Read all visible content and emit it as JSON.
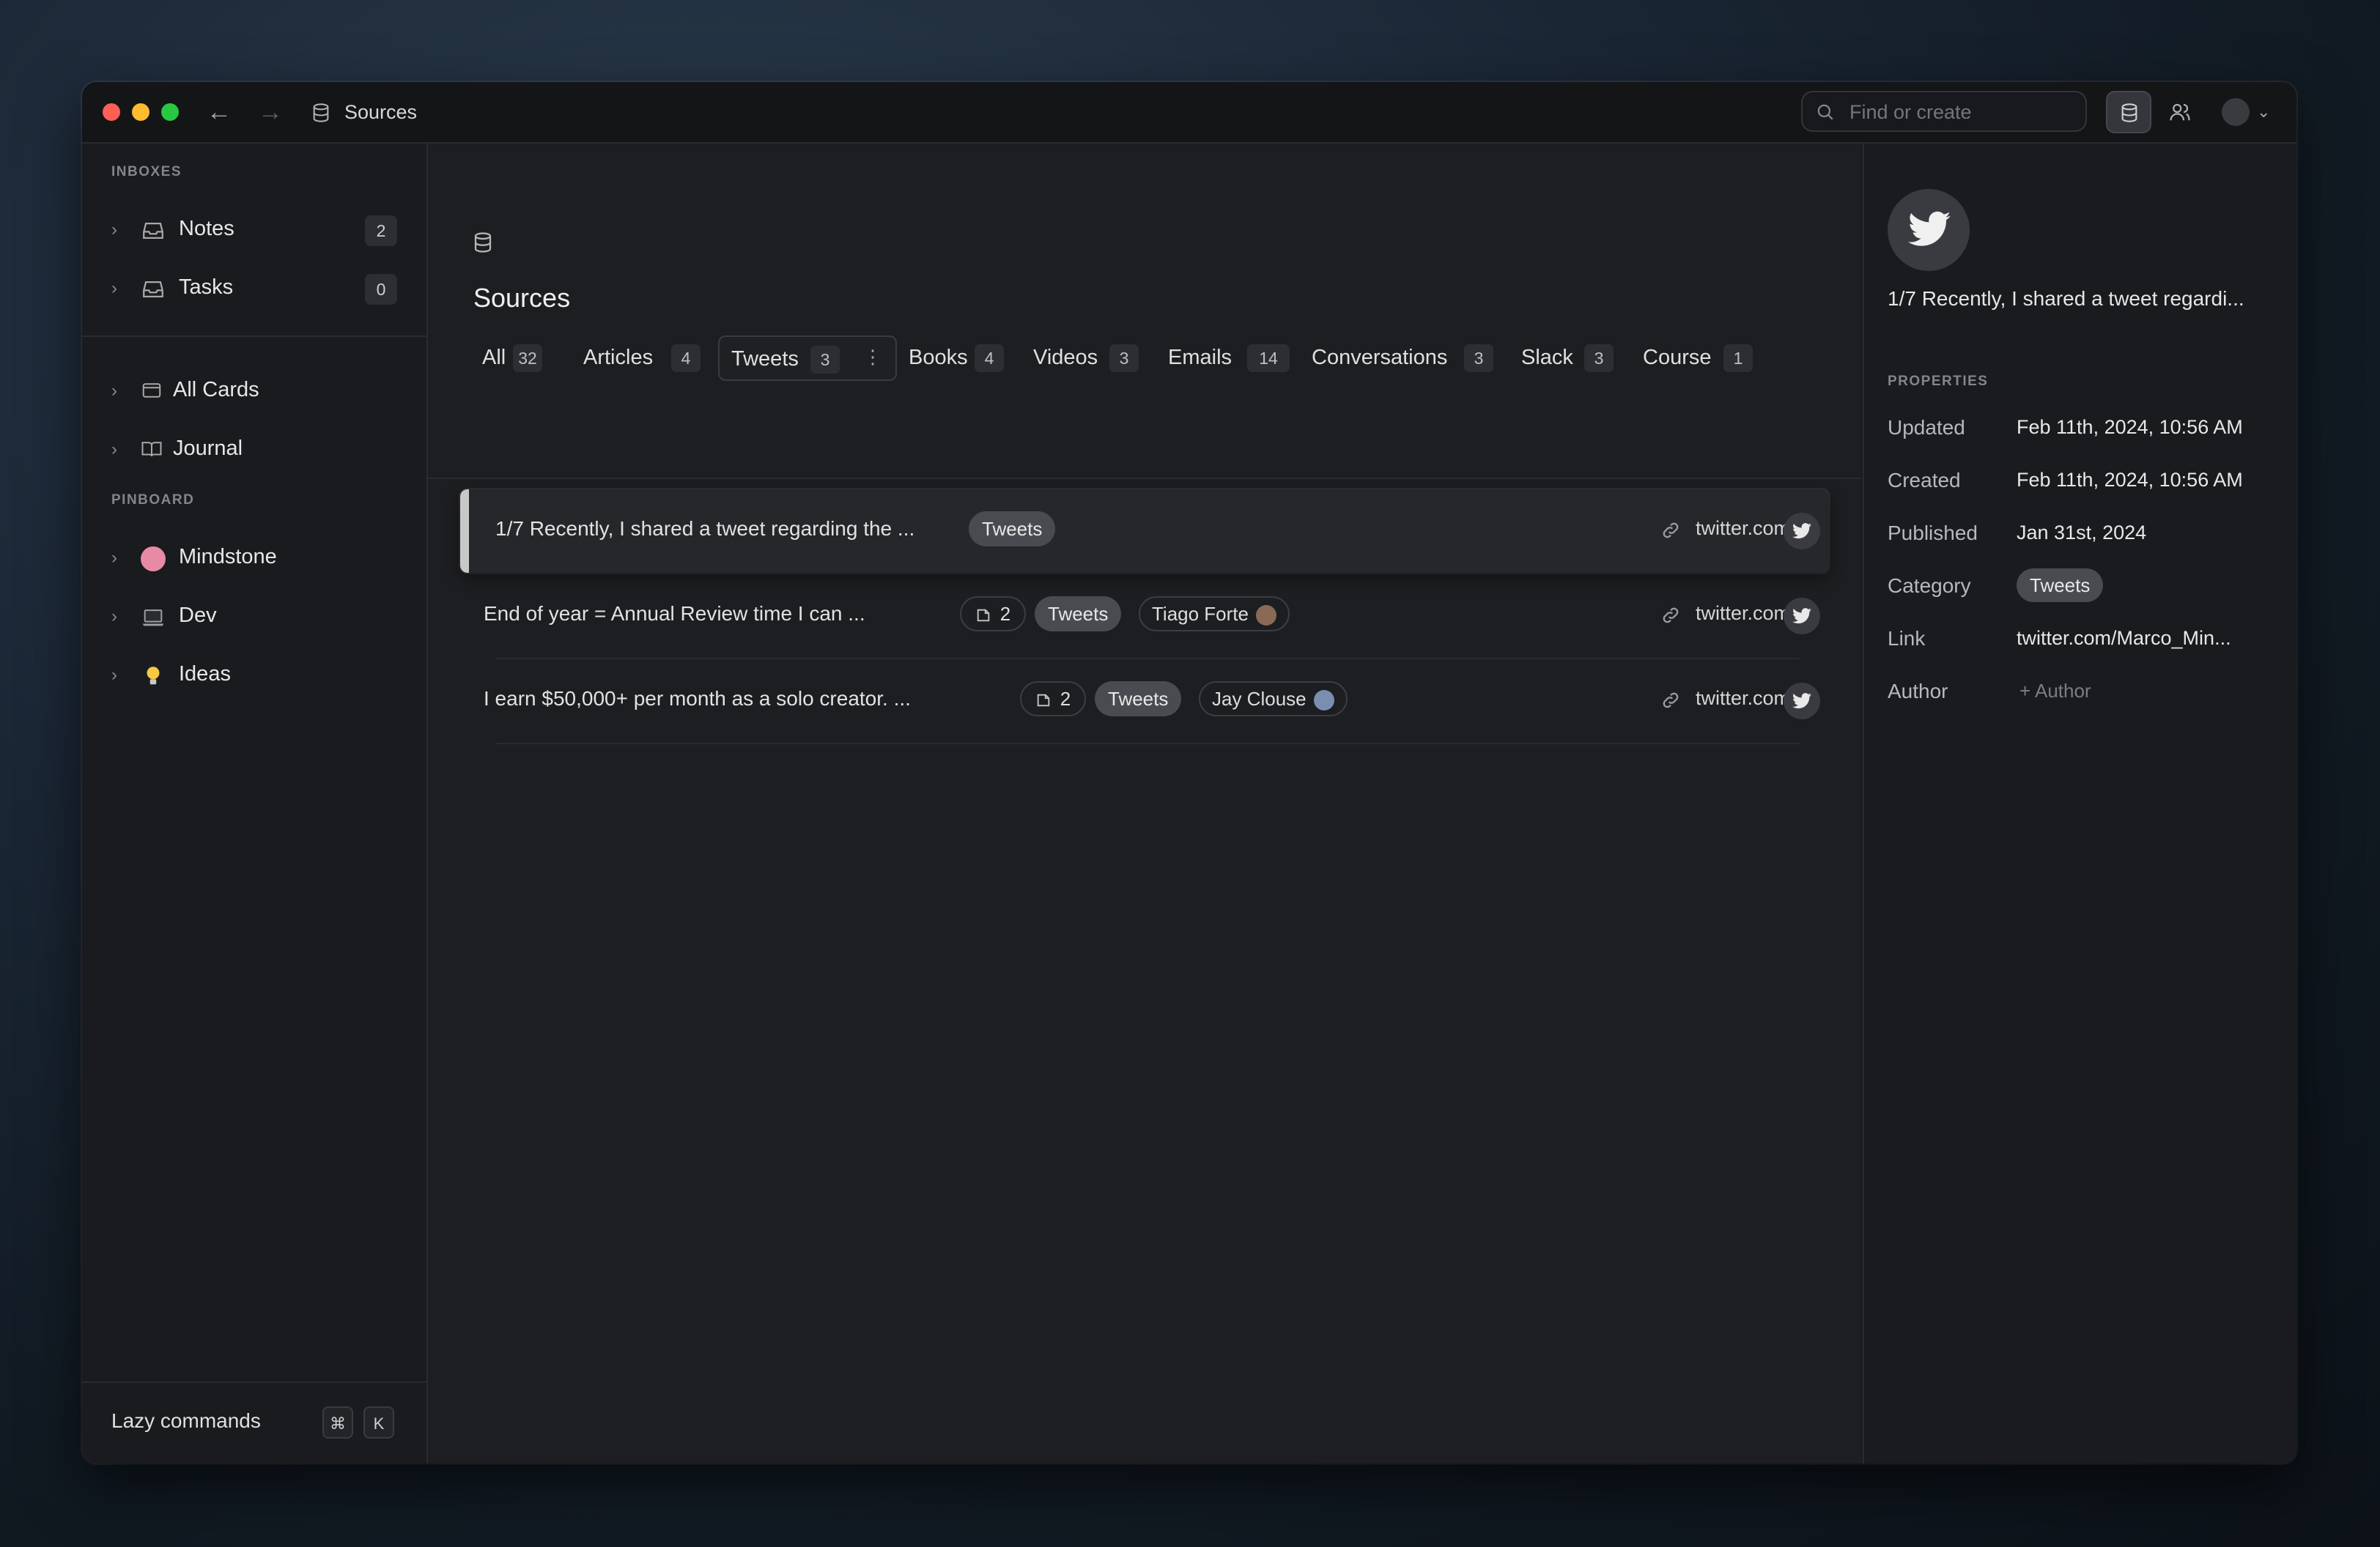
{
  "titlebar": {
    "breadcrumb": "Sources",
    "search_placeholder": "Find or create"
  },
  "sidebar": {
    "inboxes_label": "INBOXES",
    "inboxes": [
      {
        "label": "Notes",
        "count": "2"
      },
      {
        "label": "Tasks",
        "count": "0"
      }
    ],
    "nav": [
      {
        "label": "All Cards"
      },
      {
        "label": "Journal"
      }
    ],
    "pinboard_label": "PINBOARD",
    "pinboard": [
      {
        "label": "Mindstone",
        "icon": "brain-icon",
        "color": "#e88aa6"
      },
      {
        "label": "Dev",
        "icon": "laptop-icon",
        "color": "#9aa0a8"
      },
      {
        "label": "Ideas",
        "icon": "lightbulb-icon",
        "color": "#f6c945"
      }
    ],
    "footer": {
      "label": "Lazy commands",
      "key1": "⌘",
      "key2": "K"
    }
  },
  "main": {
    "title": "Sources",
    "tabs": [
      {
        "label": "All",
        "count": "32"
      },
      {
        "label": "Articles",
        "count": "4"
      },
      {
        "label": "Tweets",
        "count": "3",
        "active": true
      },
      {
        "label": "Books",
        "count": "4"
      },
      {
        "label": "Videos",
        "count": "3"
      },
      {
        "label": "Emails",
        "count": "14"
      },
      {
        "label": "Conversations",
        "count": "3"
      },
      {
        "label": "Slack",
        "count": "3"
      },
      {
        "label": "Course",
        "count": "1"
      }
    ],
    "rows": [
      {
        "title": "1/7 Recently, I shared a tweet regarding the ...",
        "tag": "Tweets",
        "domain": "twitter.com"
      },
      {
        "title": "End of year = Annual Review time I can ...",
        "cards": "2",
        "tag": "Tweets",
        "author": "Tiago Forte",
        "domain": "twitter.com"
      },
      {
        "title": "I earn $50,000+ per month as a solo creator. ...",
        "cards": "2",
        "tag": "Tweets",
        "author": "Jay Clouse",
        "domain": "twitter.com"
      }
    ]
  },
  "panel": {
    "title": "1/7 Recently, I shared a tweet regardi...",
    "properties_label": "PROPERTIES",
    "properties": {
      "updated_k": "Updated",
      "updated_v": "Feb 11th, 2024, 10:56 AM",
      "created_k": "Created",
      "created_v": "Feb 11th, 2024, 10:56 AM",
      "published_k": "Published",
      "published_v": "Jan 31st, 2024",
      "category_k": "Category",
      "category_v": "Tweets",
      "link_k": "Link",
      "link_v": "twitter.com/Marco_Min...",
      "author_k": "Author",
      "author_v": "+ Author"
    }
  },
  "colors": {
    "accent_tag": "#4a4b50",
    "background": "#1d1e21"
  }
}
